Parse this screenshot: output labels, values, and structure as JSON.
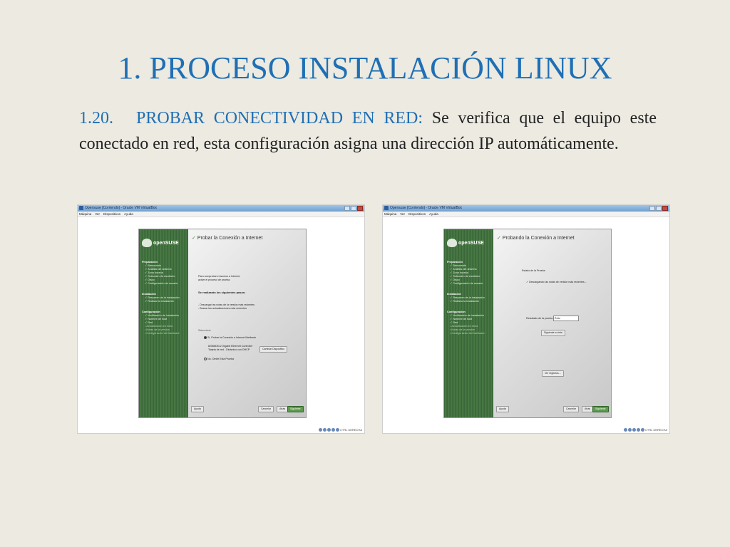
{
  "slide": {
    "title": "1. PROCESO INSTALACIÓN LINUX",
    "number": "1.20.",
    "lead": "PROBAR CONECTIVIDAD EN RED:",
    "body": " Se verifica que el equipo este conectado en red, esta configuración asigna una dirección IP automáticamente."
  },
  "window": {
    "title": "Opensuse [Corriendo] - Oracle VM VirtualBox",
    "menu": [
      "Máquina",
      "Ver",
      "Dispositivos",
      "Ayuda"
    ],
    "host_key": "CTRL DERECHA"
  },
  "installer": {
    "brand": "openSUSE",
    "sections": [
      {
        "name": "Preparación",
        "items": [
          {
            "label": "Bienvenido",
            "state": "done"
          },
          {
            "label": "Análisis del sistema",
            "state": "done"
          },
          {
            "label": "Zona horaria",
            "state": "done"
          },
          {
            "label": "Selección de escritorio",
            "state": "done"
          },
          {
            "label": "Disco",
            "state": "done"
          },
          {
            "label": "Configuración de usuario",
            "state": "done"
          }
        ]
      },
      {
        "name": "Instalación",
        "items": [
          {
            "label": "Resumen de la instalación",
            "state": "done"
          },
          {
            "label": "Realizar la instalación",
            "state": "done"
          }
        ]
      },
      {
        "name": "Configuración",
        "items": [
          {
            "label": "Verificación de instalación",
            "state": "done"
          },
          {
            "label": "Nombre de host",
            "state": "done"
          },
          {
            "label": "Red",
            "state": "done"
          },
          {
            "label": "Actualización en línea",
            "state": "pending"
          },
          {
            "label": "Notas de la versión",
            "state": "pending"
          },
          {
            "label": "Configuración del hardware",
            "state": "pending"
          }
        ]
      }
    ]
  },
  "screen1": {
    "title": "Probar la Conexión a Internet",
    "intro": [
      "Para comprobar el acceso a Internet,",
      "active el proceso de prueba."
    ],
    "steps_heading": "Se realizarán los siguientes pasos:",
    "steps": [
      "- Descargar las notas de la versión más recientes",
      "- Buscar las actualizaciones más recientes"
    ],
    "select_label": "Seleccione",
    "option_yes": "Sí, Probar la Conexión a Internet Mediante",
    "device_lines": [
      "82566DM-2 Gigabit Ethernet Controller",
      "Tarjeta de red - Dinámico con DHCP"
    ],
    "config_button": "Cambiar Dispositivo",
    "option_no": "No, Omitir Esta Prueba",
    "help": "Ayuda",
    "cancel": "Cancelar",
    "back": "Atrás",
    "next": "Siguiente"
  },
  "screen2": {
    "title": "Probando la Conexión a Internet",
    "status_heading": "Estado de la Prueba",
    "status_step": "Descargando las notas de versión más recientes...",
    "result_label": "Resultado de la prueba",
    "result_value": "Éxito",
    "log_button": "Siguiente a vista",
    "newest_button": "Ver registros...",
    "help": "Ayuda",
    "cancel": "Cancelar",
    "back": "Atrás",
    "next": "Siguiente"
  }
}
